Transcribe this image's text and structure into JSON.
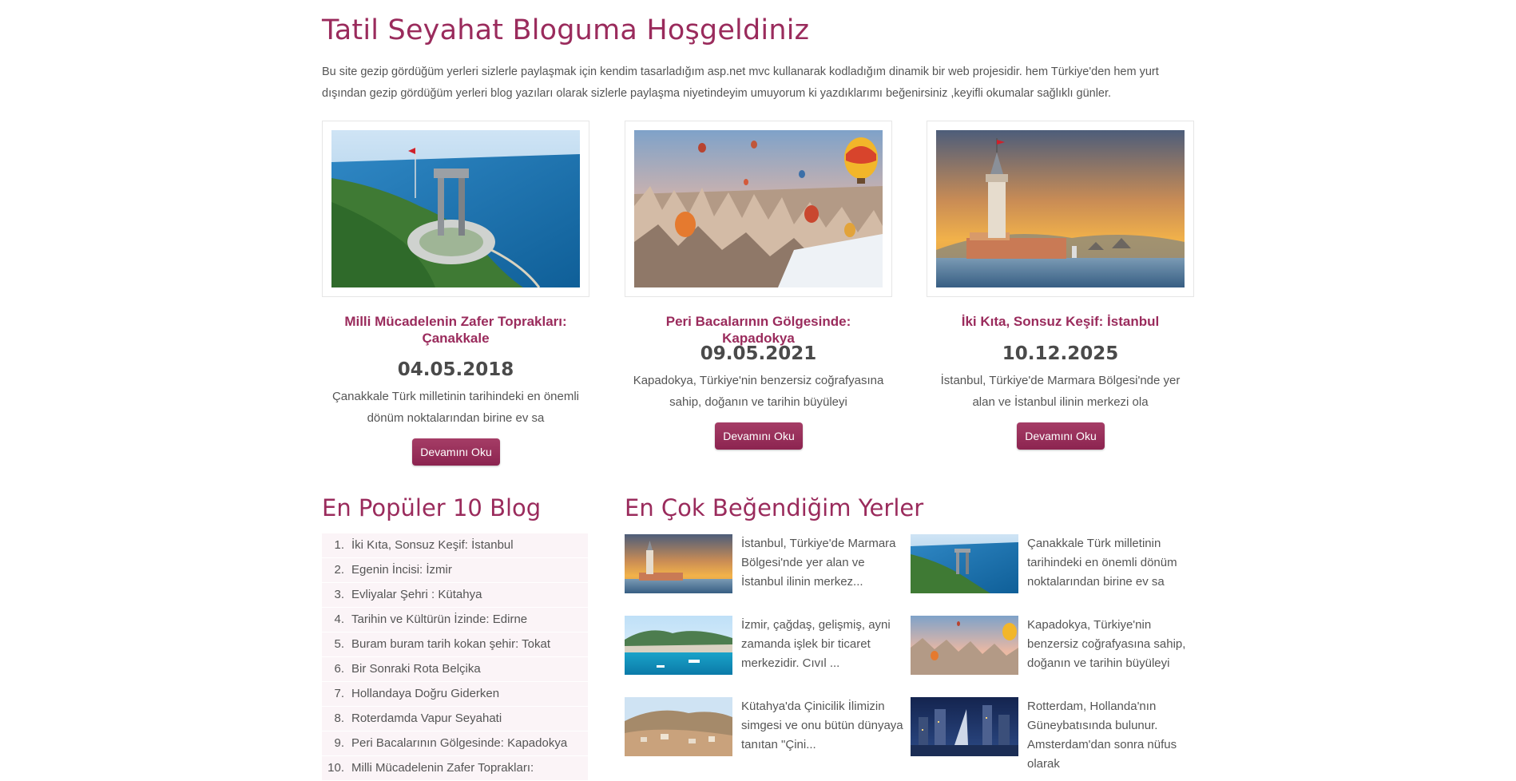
{
  "header": {
    "title": "Tatil Seyahat Bloguma Hoşgeldiniz",
    "intro": "Bu site gezip gördüğüm yerleri sizlerle paylaşmak için kendim tasarladığım asp.net mvc kullanarak kodladığım dinamik bir web projesidir. hem Türkiye'den hem yurt dışından gezip gördüğüm yerleri blog yazıları olarak sizlerle paylaşma niyetindeyim umuyorum ki yazdıklarımı beğenirsiniz ,keyifli okumalar sağlıklı günler."
  },
  "cards": [
    {
      "title": "Milli Mücadelenin Zafer Toprakları: Çanakkale",
      "date": "04.05.2018",
      "excerpt": "Çanakkale Türk milletinin tarihindeki en önemli dönüm noktalarından birine ev sa",
      "button": "Devamını Oku"
    },
    {
      "title": "Peri Bacalarının Gölgesinde: Kapadokya",
      "date": "09.05.2021",
      "excerpt": "Kapadokya, Türkiye'nin benzersiz coğrafyasına sahip, doğanın ve tarihin büyüleyi",
      "button": "Devamını Oku"
    },
    {
      "title": "İki Kıta, Sonsuz Keşif: İstanbul",
      "date": "10.12.2025",
      "excerpt": "İstanbul, Türkiye'de Marmara Bölgesi'nde yer alan ve İstanbul ilinin merkezi ola",
      "button": "Devamını Oku"
    }
  ],
  "popular": {
    "title": "En Popüler 10 Blog",
    "items": [
      {
        "num": "1.",
        "label": "İki Kıta, Sonsuz Keşif: İstanbul"
      },
      {
        "num": "2.",
        "label": "Egenin İncisi: İzmir"
      },
      {
        "num": "3.",
        "label": "Evliyalar Şehri : Kütahya"
      },
      {
        "num": "4.",
        "label": "Tarihin ve Kültürün İzinde: Edirne"
      },
      {
        "num": "5.",
        "label": "Buram buram tarih kokan şehir: Tokat"
      },
      {
        "num": "6.",
        "label": "Bir Sonraki Rota Belçika"
      },
      {
        "num": "7.",
        "label": "Hollandaya Doğru Giderken"
      },
      {
        "num": "8.",
        "label": "Roterdamda Vapur Seyahati"
      },
      {
        "num": "9.",
        "label": "Peri Bacalarının Gölgesinde: Kapadokya"
      },
      {
        "num": "10.",
        "label": "Milli Mücadelenin Zafer Toprakları:"
      }
    ]
  },
  "favorites": {
    "title": "En Çok Beğendiğim Yerler",
    "items": [
      {
        "text": "İstanbul, Türkiye'de Marmara Bölgesi'nde yer alan ve İstanbul ilinin merkez...",
        "image": "istanbul-tower"
      },
      {
        "text": "Çanakkale Türk milletinin tarihindeki en önemli dönüm noktalarından birine ev sa",
        "image": "canakkale-monument"
      },
      {
        "text": "İzmir, çağdaş, gelişmiş, ayni zamanda işlek bir ticaret merkezidir. Cıvıl ...",
        "image": "izmir-coast"
      },
      {
        "text": "Kapadokya, Türkiye'nin benzersiz coğrafyasına sahip, doğanın ve tarihin büyüleyi",
        "image": "kapadokya-balloons"
      },
      {
        "text": "Kütahya'da Çinicilik İlimizin simgesi ve onu bütün dünyaya tanıtan \"Çini...",
        "image": "kutahya-city"
      },
      {
        "text": "Rotterdam, Hollanda'nın Güneybatısında bulunur. Amsterdam'dan sonra nüfus olarak",
        "image": "rotterdam-night"
      }
    ]
  },
  "colors": {
    "accent": "#9a2b5c",
    "button": "#9a2f5a",
    "list_bg": "#fbf4f7"
  }
}
